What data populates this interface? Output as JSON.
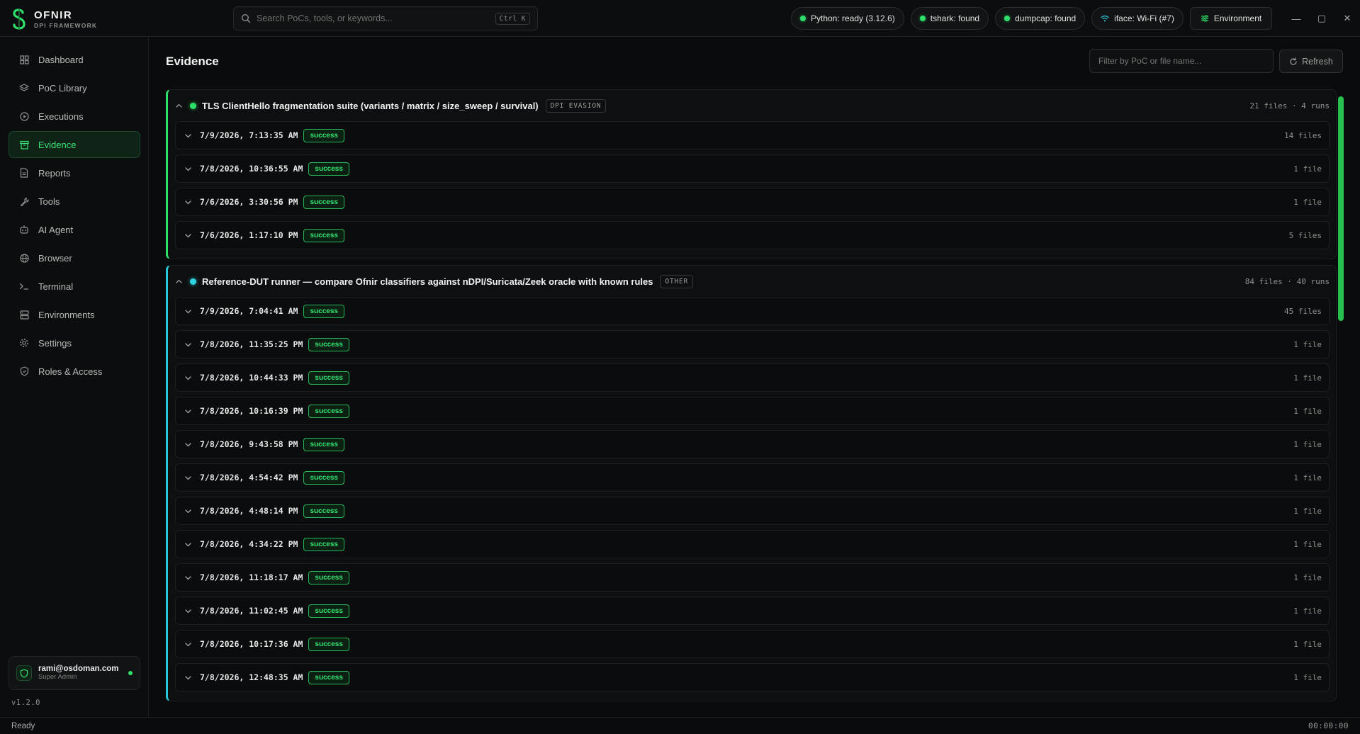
{
  "app": {
    "name": "OFNIR",
    "subtitle": "DPI FRAMEWORK",
    "version": "v1.2.0"
  },
  "search": {
    "placeholder": "Search PoCs, tools, or keywords...",
    "shortcut": "Ctrl K"
  },
  "status_pills": [
    {
      "label": "Python: ready (3.12.6)",
      "indicator": "green-dot"
    },
    {
      "label": "tshark: found",
      "indicator": "green-dot"
    },
    {
      "label": "dumpcap: found",
      "indicator": "green-dot"
    },
    {
      "label": "iface: Wi-Fi (#7)",
      "indicator": "wifi-icon"
    }
  ],
  "environment_button": {
    "label": "Environment",
    "icon": "sliders-icon"
  },
  "window_controls": {
    "minimize": "—",
    "maximize": "▢",
    "close": "✕"
  },
  "sidebar": {
    "items": [
      {
        "label": "Dashboard",
        "icon": "grid-icon",
        "active": false
      },
      {
        "label": "PoC Library",
        "icon": "layers-icon",
        "active": false
      },
      {
        "label": "Executions",
        "icon": "play-circle-icon",
        "active": false
      },
      {
        "label": "Evidence",
        "icon": "archive-icon",
        "active": true
      },
      {
        "label": "Reports",
        "icon": "file-icon",
        "active": false
      },
      {
        "label": "Tools",
        "icon": "wrench-icon",
        "active": false
      },
      {
        "label": "AI Agent",
        "icon": "robot-icon",
        "active": false
      },
      {
        "label": "Browser",
        "icon": "globe-icon",
        "active": false
      },
      {
        "label": "Terminal",
        "icon": "terminal-icon",
        "active": false
      },
      {
        "label": "Environments",
        "icon": "server-icon",
        "active": false
      },
      {
        "label": "Settings",
        "icon": "gear-icon",
        "active": false
      },
      {
        "label": "Roles & Access",
        "icon": "shield-icon",
        "active": false
      }
    ],
    "user": {
      "email": "rami@osdoman.com",
      "role": "Super Admin"
    }
  },
  "main": {
    "title": "Evidence",
    "filter_placeholder": "Filter by PoC or file name...",
    "refresh_label": "Refresh",
    "groups": [
      {
        "title": "TLS ClientHello fragmentation suite (variants / matrix / size_sweep / survival)",
        "tag": "DPI EVASION",
        "meta": "21 files · 4 runs",
        "accent": "#2ee06a",
        "runs": [
          {
            "time": "7/9/2026, 7:13:35 AM",
            "status": "success",
            "files": "14 files"
          },
          {
            "time": "7/8/2026, 10:36:55 AM",
            "status": "success",
            "files": "1 file"
          },
          {
            "time": "7/6/2026, 3:30:56 PM",
            "status": "success",
            "files": "1 file"
          },
          {
            "time": "7/6/2026, 1:17:10 PM",
            "status": "success",
            "files": "5 files"
          }
        ]
      },
      {
        "title": "Reference-DUT runner — compare Ofnir classifiers against nDPI/Suricata/Zeek oracle with known rules",
        "tag": "OTHER",
        "meta": "84 files · 40 runs",
        "accent": "#27c9d9",
        "runs": [
          {
            "time": "7/9/2026, 7:04:41 AM",
            "status": "success",
            "files": "45 files"
          },
          {
            "time": "7/8/2026, 11:35:25 PM",
            "status": "success",
            "files": "1 file"
          },
          {
            "time": "7/8/2026, 10:44:33 PM",
            "status": "success",
            "files": "1 file"
          },
          {
            "time": "7/8/2026, 10:16:39 PM",
            "status": "success",
            "files": "1 file"
          },
          {
            "time": "7/8/2026, 9:43:58 PM",
            "status": "success",
            "files": "1 file"
          },
          {
            "time": "7/8/2026, 4:54:42 PM",
            "status": "success",
            "files": "1 file"
          },
          {
            "time": "7/8/2026, 4:48:14 PM",
            "status": "success",
            "files": "1 file"
          },
          {
            "time": "7/8/2026, 4:34:22 PM",
            "status": "success",
            "files": "1 file"
          },
          {
            "time": "7/8/2026, 11:18:17 AM",
            "status": "success",
            "files": "1 file"
          },
          {
            "time": "7/8/2026, 11:02:45 AM",
            "status": "success",
            "files": "1 file"
          },
          {
            "time": "7/8/2026, 10:17:36 AM",
            "status": "success",
            "files": "1 file"
          },
          {
            "time": "7/8/2026, 12:48:35 AM",
            "status": "success",
            "files": "1 file"
          }
        ]
      }
    ]
  },
  "statusbar": {
    "left": "Ready",
    "timer": "00:00:00"
  },
  "colors": {
    "accent_green": "#2ee06a",
    "accent_cyan": "#27c9d9",
    "background": "#0a0b0c"
  }
}
